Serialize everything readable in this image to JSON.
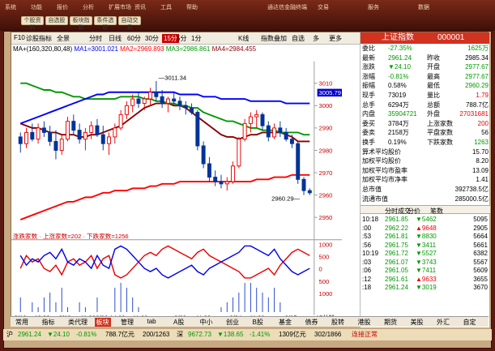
{
  "topmenu": [
    "系统",
    "功能",
    "报价",
    "分析",
    "扩展市场",
    "资讯",
    "工具",
    "帮助"
  ],
  "topright": [
    "通达信金融终端",
    "交易",
    "服务",
    "数据"
  ],
  "toolbuttons": [
    "个股资料",
    "自选股",
    "板块指数",
    "条件选股",
    "自动交易"
  ],
  "toolbar": {
    "items": [
      "F10",
      "诊股",
      "指标",
      "全景",
      "分时",
      "日线",
      "60分",
      "30分",
      "15分",
      "5分",
      "1分",
      "K线",
      "指数叠加",
      "自选",
      "多",
      "更多"
    ],
    "selected": "15分"
  },
  "ma_legend": {
    "ma": "MA+(160,320,80,48)",
    "ma1": "MA1=3001.021",
    "ma2": "MA2=2969.893",
    "ma3": "MA3=2986.861",
    "ma4": "MA4=2984.455",
    "colors": {
      "ma1": "#0000ff",
      "ma2": "#ff0000",
      "ma3": "#009900",
      "ma4": "#880000"
    }
  },
  "chart_data": {
    "type": "candlestick",
    "price_axis": {
      "ticks": [
        3010,
        3000,
        2990,
        2980,
        2970,
        2960,
        2950
      ],
      "current": "3005.79"
    },
    "annotations": {
      "high": "3011.34",
      "low": "2960.29"
    },
    "volume_label": "涨跌家数 · 上涨家数=202 · 下跌家数=1256",
    "volume_axis": {
      "ticks": [
        1000,
        500,
        0,
        500,
        1000
      ]
    },
    "time_labels": [
      "9/18",
      "13:30",
      "9/19",
      "11:00",
      "9/20",
      "14:30",
      "11:00",
      "9/23",
      "11:00",
      "9/24",
      "11:00",
      "9/25"
    ],
    "interval": "15分钟",
    "candles": [
      {
        "o": 2986,
        "h": 2988,
        "l": 2979,
        "c": 2983
      },
      {
        "o": 2983,
        "h": 2990,
        "l": 2981,
        "c": 2988
      },
      {
        "o": 2988,
        "h": 2992,
        "l": 2984,
        "c": 2985
      },
      {
        "o": 2985,
        "h": 2992,
        "l": 2983,
        "c": 2990
      },
      {
        "o": 2990,
        "h": 2993,
        "l": 2986,
        "c": 2988
      },
      {
        "o": 2988,
        "h": 2991,
        "l": 2982,
        "c": 2984
      },
      {
        "o": 2984,
        "h": 2989,
        "l": 2976,
        "c": 2980
      },
      {
        "o": 2980,
        "h": 2987,
        "l": 2978,
        "c": 2985
      },
      {
        "o": 2985,
        "h": 2995,
        "l": 2984,
        "c": 2993
      },
      {
        "o": 2993,
        "h": 2996,
        "l": 2987,
        "c": 2989
      },
      {
        "o": 2989,
        "h": 2992,
        "l": 2983,
        "c": 2985
      },
      {
        "o": 2985,
        "h": 2990,
        "l": 2980,
        "c": 2988
      },
      {
        "o": 2988,
        "h": 2993,
        "l": 2985,
        "c": 2991
      },
      {
        "o": 2991,
        "h": 2994,
        "l": 2986,
        "c": 2987
      },
      {
        "o": 2987,
        "h": 2991,
        "l": 2980,
        "c": 2983
      },
      {
        "o": 2983,
        "h": 2988,
        "l": 2978,
        "c": 2986
      },
      {
        "o": 2986,
        "h": 2992,
        "l": 2983,
        "c": 2990
      },
      {
        "o": 2990,
        "h": 2998,
        "l": 2989,
        "c": 2996
      },
      {
        "o": 2996,
        "h": 3002,
        "l": 2994,
        "c": 3000
      },
      {
        "o": 3000,
        "h": 3005,
        "l": 2997,
        "c": 3003
      },
      {
        "o": 3003,
        "h": 3006,
        "l": 2999,
        "c": 3001
      },
      {
        "o": 3001,
        "h": 3004,
        "l": 2998,
        "c": 3003
      },
      {
        "o": 3003,
        "h": 3008,
        "l": 3000,
        "c": 3006
      },
      {
        "o": 3006,
        "h": 3011,
        "l": 3002,
        "c": 3004
      },
      {
        "o": 3004,
        "h": 3007,
        "l": 2999,
        "c": 3001
      },
      {
        "o": 3001,
        "h": 3004,
        "l": 2997,
        "c": 3003
      },
      {
        "o": 3003,
        "h": 3006,
        "l": 3000,
        "c": 3002
      },
      {
        "o": 3002,
        "h": 3004,
        "l": 2998,
        "c": 3000
      },
      {
        "o": 3000,
        "h": 3002,
        "l": 2996,
        "c": 2999
      },
      {
        "o": 2999,
        "h": 3001,
        "l": 2996,
        "c": 2997
      },
      {
        "o": 2997,
        "h": 2998,
        "l": 2980,
        "c": 2982
      },
      {
        "o": 2982,
        "h": 2984,
        "l": 2972,
        "c": 2974
      },
      {
        "o": 2974,
        "h": 2977,
        "l": 2966,
        "c": 2968
      },
      {
        "o": 2968,
        "h": 2971,
        "l": 2964,
        "c": 2966
      },
      {
        "o": 2966,
        "h": 2969,
        "l": 2963,
        "c": 2965
      },
      {
        "o": 2965,
        "h": 2968,
        "l": 2962,
        "c": 2966
      },
      {
        "o": 2966,
        "h": 2975,
        "l": 2965,
        "c": 2973
      },
      {
        "o": 2973,
        "h": 2986,
        "l": 2972,
        "c": 2985
      },
      {
        "o": 2985,
        "h": 2994,
        "l": 2984,
        "c": 2992
      },
      {
        "o": 2992,
        "h": 2997,
        "l": 2988,
        "c": 2995
      },
      {
        "o": 2995,
        "h": 2998,
        "l": 2990,
        "c": 2996
      },
      {
        "o": 2996,
        "h": 2997,
        "l": 2989,
        "c": 2991
      },
      {
        "o": 2991,
        "h": 2993,
        "l": 2984,
        "c": 2986
      },
      {
        "o": 2986,
        "h": 2992,
        "l": 2985,
        "c": 2990
      },
      {
        "o": 2990,
        "h": 2993,
        "l": 2986,
        "c": 2988
      },
      {
        "o": 2988,
        "h": 2990,
        "l": 2984,
        "c": 2985
      },
      {
        "o": 2985,
        "h": 2987,
        "l": 2981,
        "c": 2983
      },
      {
        "o": 2983,
        "h": 2984,
        "l": 2965,
        "c": 2967
      },
      {
        "o": 2967,
        "h": 2968,
        "l": 2960,
        "c": 2962
      },
      {
        "o": 2962,
        "h": 2963,
        "l": 2960,
        "c": 2961
      }
    ],
    "ma1": [
      2992,
      2993,
      2994,
      2995,
      2996,
      2997,
      2998,
      2999,
      3000,
      3001,
      3002,
      3003,
      3004,
      3005,
      3005,
      3006,
      3006,
      3006,
      3006,
      3006,
      3006,
      3006,
      3006,
      3006,
      3006,
      3006,
      3006,
      3005,
      3005,
      3005,
      3005,
      3004,
      3004,
      3004,
      3003,
      3003,
      3003,
      3003,
      3003,
      3002,
      3002,
      3002,
      3002,
      3002,
      3002,
      3001,
      3001,
      3001,
      3001,
      3001
    ],
    "ma2": [
      2949,
      2950,
      2951,
      2952,
      2953,
      2954,
      2955,
      2956,
      2957,
      2957,
      2958,
      2959,
      2959,
      2960,
      2961,
      2961,
      2962,
      2962,
      2962,
      2963,
      2963,
      2963,
      2964,
      2964,
      2965,
      2965,
      2965,
      2966,
      2966,
      2966,
      2966,
      2966,
      2966,
      2966,
      2966,
      2966,
      2966,
      2966,
      2966,
      2966,
      2967,
      2967,
      2967,
      2968,
      2968,
      2968,
      2969,
      2969,
      2969,
      2969
    ],
    "ma3": [
      3010,
      3010,
      3009,
      3008,
      3007,
      3007,
      3006,
      3006,
      3005,
      3004,
      3004,
      3003,
      3003,
      3003,
      3003,
      3003,
      3003,
      3004,
      3004,
      3004,
      3004,
      3003,
      3003,
      3002,
      3002,
      3001,
      3001,
      3000,
      3000,
      2999,
      2999,
      2997,
      2996,
      2995,
      2994,
      2993,
      2993,
      2992,
      2991,
      2990,
      2990,
      2989,
      2989,
      2989,
      2988,
      2988,
      2988,
      2988,
      2987,
      2987
    ],
    "ma4": [
      2992,
      2991,
      2990,
      2990,
      2989,
      2988,
      2988,
      2987,
      2987,
      2987,
      2986,
      2986,
      2987,
      2987,
      2988,
      2989,
      2990,
      2991,
      2993,
      2995,
      2997,
      2999,
      3000,
      3001,
      3001,
      3001,
      3000,
      3000,
      2999,
      2997,
      2995,
      2993,
      2991,
      2989,
      2987,
      2986,
      2986,
      2985,
      2986,
      2987,
      2987,
      2988,
      2988,
      2988,
      2988,
      2987,
      2986,
      2984,
      2984,
      2984
    ],
    "up_counts": [
      500,
      900,
      700,
      800,
      500,
      400,
      600,
      300,
      700,
      800,
      600,
      700,
      900,
      500,
      800,
      900,
      300,
      200,
      300,
      500,
      700,
      900,
      1000,
      900,
      1100,
      1200,
      1100,
      1000,
      900,
      800,
      1000,
      1100,
      900,
      800,
      700,
      600,
      500,
      400,
      200,
      200,
      300,
      400,
      500,
      300,
      600,
      800,
      1000,
      1100,
      1000,
      900
    ],
    "down_counts": [
      900,
      600,
      800,
      700,
      900,
      1000,
      800,
      1100,
      700,
      600,
      800,
      700,
      500,
      900,
      600,
      500,
      1100,
      1200,
      1100,
      900,
      700,
      500,
      400,
      500,
      300,
      200,
      300,
      400,
      500,
      600,
      400,
      300,
      500,
      600,
      700,
      800,
      900,
      1000,
      1200,
      1200,
      1100,
      1000,
      900,
      1100,
      800,
      600,
      400,
      300,
      400,
      500
    ],
    "breadth_bars": [
      0,
      0,
      0,
      0,
      0,
      0,
      0,
      0,
      0,
      0,
      0,
      0,
      0,
      0,
      0,
      0,
      0,
      0,
      0,
      0,
      0,
      0,
      0,
      0,
      0,
      0,
      0,
      0,
      0,
      0,
      0,
      0,
      0,
      0,
      0,
      0,
      0,
      0,
      0,
      0,
      0,
      0,
      0,
      0,
      0,
      0,
      0,
      0,
      0,
      0
    ]
  },
  "quote": {
    "name": "上证指数",
    "code": "000001",
    "rows": [
      {
        "l1": "委比",
        "v1": "-27.35%",
        "l2": "",
        "v2": "1625万",
        "c1": "grn",
        "c2": "grn"
      },
      {
        "l1": "最新",
        "v1": "2961.24",
        "l2": "昨收",
        "v2": "2985.34",
        "c1": "grn",
        "c2": ""
      },
      {
        "l1": "涨跌",
        "v1": "▼24.10",
        "l2": "开盘",
        "v2": "2977.67",
        "c1": "grn",
        "c2": "grn"
      },
      {
        "l1": "涨幅",
        "v1": "-0.81%",
        "l2": "最高",
        "v2": "2977.67",
        "c1": "grn",
        "c2": "grn"
      },
      {
        "l1": "振幅",
        "v1": "0.58%",
        "l2": "最低",
        "v2": "2960.29",
        "c1": "",
        "c2": "grn"
      },
      {
        "l1": "现手",
        "v1": "73019",
        "l2": "量比",
        "v2": "1.79",
        "c1": "",
        "c2": "red"
      },
      {
        "l1": "总手",
        "v1": "6294万",
        "l2": "总额",
        "v2": "788.7亿",
        "c1": "",
        "c2": ""
      },
      {
        "l1": "内盘",
        "v1": "35904721",
        "l2": "外盘",
        "v2": "27031681",
        "c1": "grn",
        "c2": "red"
      },
      {
        "l1": "委买",
        "v1": "3784万",
        "l2": "上涨家数",
        "v2": "200",
        "c1": "",
        "c2": "red"
      },
      {
        "l1": "委卖",
        "v1": "2158万",
        "l2": "平盘家数",
        "v2": "56",
        "c1": "",
        "c2": ""
      },
      {
        "l1": "换手",
        "v1": "0.19%",
        "l2": "下跌家数",
        "v2": "1263",
        "c1": "",
        "c2": "grn"
      },
      {
        "l1": "算术平均股价",
        "v1": "",
        "l2": "",
        "v2": "15.70",
        "c1": "",
        "c2": ""
      },
      {
        "l1": "加权平均股价",
        "v1": "",
        "l2": "",
        "v2": "8.20",
        "c1": "",
        "c2": ""
      },
      {
        "l1": "加权平均市盈率",
        "v1": "",
        "l2": "",
        "v2": "13.09",
        "c1": "",
        "c2": ""
      },
      {
        "l1": "加权平均市净率",
        "v1": "",
        "l2": "",
        "v2": "1.41",
        "c1": "",
        "c2": ""
      },
      {
        "l1": "总市值",
        "v1": "",
        "l2": "",
        "v2": "392738.5亿",
        "c1": "",
        "c2": ""
      },
      {
        "l1": "流通市值",
        "v1": "",
        "l2": "",
        "v2": "285000.5亿",
        "c1": "",
        "c2": ""
      }
    ],
    "tabs": [
      "分时成交",
      "分价",
      "笔数"
    ],
    "ticks": [
      {
        "t": "10:18",
        "p": "2961.85",
        "v": "▼5462",
        "n": "5095"
      },
      {
        "t": ":00",
        "p": "2962.22",
        "v": "▲9648",
        "n": "2905"
      },
      {
        "t": ":53",
        "p": "2961.81",
        "v": "▼8830",
        "n": "5664"
      },
      {
        "t": ":56",
        "p": "2961.75",
        "v": "▼3411",
        "n": "5661"
      },
      {
        "t": "10:19",
        "p": "2961.72",
        "v": "▼5527",
        "n": "6382"
      },
      {
        "t": ":03",
        "p": "2961.07",
        "v": "▼3743",
        "n": "5567"
      },
      {
        "t": ":06",
        "p": "2961.05",
        "v": "▼7411",
        "n": "5609"
      },
      {
        "t": ":12",
        "p": "2961.61",
        "v": "▲9633",
        "n": "3655"
      },
      {
        "t": ":18",
        "p": "2961.24",
        "v": "▼3019",
        "n": "3670"
      }
    ]
  },
  "bottom_tabs": [
    "常用",
    "指标",
    "类代理",
    "板块",
    "管理",
    "tab",
    "A股",
    "中小",
    "创业",
    "B股",
    "基金",
    "债券",
    "股转",
    "港股",
    "期货",
    "美股",
    "外汇",
    "自定"
  ],
  "bottom_selected": "板块",
  "status": {
    "index1_name": "沪",
    "index1": "2961.24",
    "index1_chg": "▼24.10",
    "index1_pct": "-0.81%",
    "index1_amt": "788.7亿元",
    "index1_ud": "200/1263",
    "index2_name": "深",
    "index2": "9672.73",
    "index2_chg": "▼138.65",
    "index2_pct": "-1.41%",
    "index2_amt": "1309亿元",
    "index2_ud": "302/1866",
    "conn": "连接正常"
  }
}
